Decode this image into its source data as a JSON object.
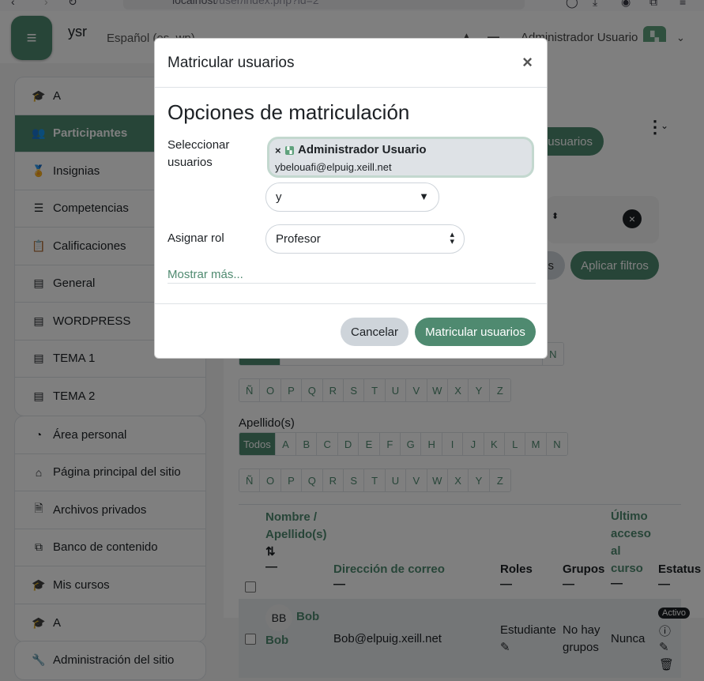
{
  "browser": {
    "url_host": "localhost",
    "url_path": "/user/index.php?id=2"
  },
  "navbar": {
    "site_name": "ysr",
    "language": "Español (es_wp)",
    "user_name": "Administrador Usuario"
  },
  "sidebar": {
    "course_items": [
      {
        "label": "A",
        "icon": "graduation-cap-icon",
        "glyph": "🎓"
      },
      {
        "label": "Participantes",
        "icon": "users-icon",
        "glyph": "👥",
        "active": true
      },
      {
        "label": "Insignias",
        "icon": "badge-icon",
        "glyph": "🏅"
      },
      {
        "label": "Competencias",
        "icon": "list-check-icon",
        "glyph": "☰"
      },
      {
        "label": "Calificaciones",
        "icon": "clipboard-icon",
        "glyph": "📋"
      },
      {
        "label": "General",
        "icon": "list-alt-icon",
        "glyph": "▤"
      },
      {
        "label": "WORDPRESS",
        "icon": "list-alt-icon",
        "glyph": "▤"
      },
      {
        "label": "TEMA 1",
        "icon": "list-alt-icon",
        "glyph": "▤"
      },
      {
        "label": "TEMA 2",
        "icon": "list-alt-icon",
        "glyph": "▤"
      }
    ],
    "site_items": [
      {
        "label": "Área personal",
        "icon": "dashboard-icon",
        "glyph": "◔"
      },
      {
        "label": "Página principal del sitio",
        "icon": "home-icon",
        "glyph": "⌂"
      },
      {
        "label": "Archivos privados",
        "icon": "file-icon",
        "glyph": "🗎"
      },
      {
        "label": "Banco de contenido",
        "icon": "content-bank-icon",
        "glyph": "⧉"
      },
      {
        "label": "Mis cursos",
        "icon": "graduation-cap-icon",
        "glyph": "🎓"
      },
      {
        "label": "A",
        "icon": "graduation-cap-icon",
        "glyph": "🎓"
      }
    ],
    "admin_items": [
      {
        "label": "Administración del sitio",
        "icon": "wrench-icon",
        "glyph": "🔧"
      }
    ]
  },
  "main": {
    "enrol_button_partial": "usuarios",
    "clear_filters_partial": "s",
    "apply_filters": "Aplicar filtros",
    "first_row_letters_partial": [
      "N"
    ],
    "letters_row2": [
      "Ñ",
      "O",
      "P",
      "Q",
      "R",
      "S",
      "T",
      "U",
      "V",
      "W",
      "X",
      "Y",
      "Z"
    ],
    "surname_label": "Apellido(s)",
    "surname_letters": [
      "Todos",
      "A",
      "B",
      "C",
      "D",
      "E",
      "F",
      "G",
      "H",
      "I",
      "J",
      "K",
      "L",
      "M",
      "N"
    ],
    "table": {
      "headers": {
        "name": "Nombre / Apellido(s)",
        "email": "Dirección de correo",
        "roles": "Roles",
        "groups": "Grupos",
        "last_access": "Último acceso al curso",
        "status": "Estatus"
      },
      "rows": [
        {
          "initials": "BB",
          "first_name": "Bob",
          "last_name": "Bob",
          "email": "Bob@elpuig.xeill.net",
          "role": "Estudiante",
          "groups": "No hay grupos",
          "last_access": "Nunca",
          "status": "Activo"
        }
      ]
    }
  },
  "modal": {
    "title": "Matricular usuarios",
    "section_title": "Opciones de matriculación",
    "select_users_label": "Seleccionar usuarios",
    "selected_user_name": "Administrador Usuario",
    "selected_user_email": "ybelouafi@elpuig.xeill.net",
    "search_value": "y",
    "assign_role_label": "Asignar rol",
    "role_value": "Profesor",
    "show_more": "Mostrar más...",
    "cancel": "Cancelar",
    "submit": "Matricular usuarios"
  }
}
